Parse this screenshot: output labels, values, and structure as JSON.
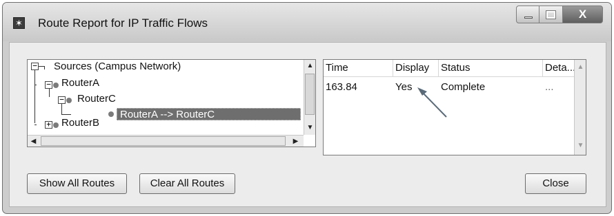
{
  "window": {
    "title": "Route Report for IP Traffic Flows",
    "icon": "app-icon",
    "controls": {
      "minimize": "minimize-icon",
      "maximize": "maximize-icon",
      "close_glyph": "X"
    }
  },
  "tree": {
    "nodes": [
      {
        "label": "Sources (Campus Network)",
        "expander": "−"
      },
      {
        "label": "RouterA",
        "expander": "−"
      },
      {
        "label": "RouterC",
        "expander": "−"
      },
      {
        "label": "RouterA --> RouterC",
        "selected": true
      },
      {
        "label": "RouterB",
        "expander": "+"
      }
    ]
  },
  "table": {
    "columns": [
      "Time",
      "Display",
      "Status",
      "Deta..."
    ],
    "rows": [
      [
        "163.84",
        "Yes",
        "Complete",
        "..."
      ]
    ]
  },
  "buttons": {
    "show_all": "Show All Routes",
    "clear_all": "Clear All Routes",
    "close": "Close"
  },
  "colors": {
    "selection": "#6e6e6e",
    "annotation_arrow": "#5a6a78"
  }
}
